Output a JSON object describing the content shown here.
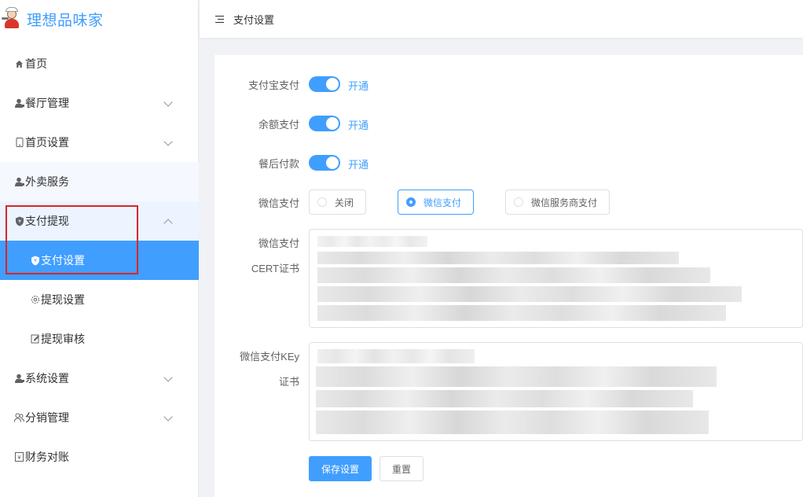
{
  "brand": {
    "title": "理想品味家"
  },
  "sidebar": {
    "items": [
      {
        "label": "首页",
        "icon": "home-icon"
      },
      {
        "label": "餐厅管理",
        "icon": "user-icon"
      },
      {
        "label": "首页设置",
        "icon": "phone-icon"
      },
      {
        "label": "外卖服务",
        "icon": "user-icon"
      },
      {
        "label": "支付提现",
        "icon": "shield-icon"
      },
      {
        "label": "支付设置",
        "icon": "shield-icon"
      },
      {
        "label": "提现设置",
        "icon": "settings-icon"
      },
      {
        "label": "提现审核",
        "icon": "edit-icon"
      },
      {
        "label": "系统设置",
        "icon": "user-icon"
      },
      {
        "label": "分销管理",
        "icon": "users-icon"
      },
      {
        "label": "财务对账",
        "icon": "ledger-icon"
      }
    ]
  },
  "header": {
    "breadcrumb": "支付设置"
  },
  "form": {
    "alipay": {
      "label": "支付宝支付",
      "status": "开通",
      "enabled": true
    },
    "balance": {
      "label": "余额支付",
      "status": "开通",
      "enabled": true
    },
    "after_meal": {
      "label": "餐后付款",
      "status": "开通",
      "enabled": true
    },
    "wechat": {
      "label": "微信支付",
      "options": [
        "关闭",
        "微信支付",
        "微信服务商支付"
      ],
      "selected": "微信支付"
    },
    "cert": {
      "label_line1": "微信支付",
      "label_line2": "CERT证书"
    },
    "key": {
      "label_line1": "微信支付KEy",
      "label_line2": "证书"
    },
    "save_label": "保存设置",
    "reset_label": "重置"
  },
  "colors": {
    "accent": "#409eff",
    "highlight_box": "#d9252c"
  }
}
